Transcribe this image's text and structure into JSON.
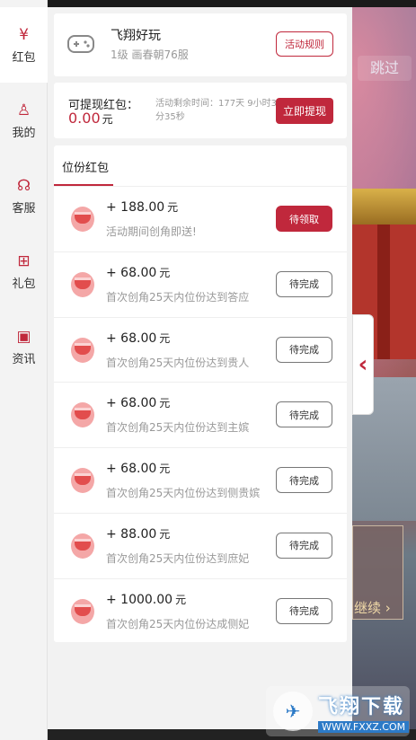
{
  "sidebar": {
    "items": [
      {
        "label": "红包",
        "icon": "red-envelope-icon",
        "glyph": "¥",
        "active": true
      },
      {
        "label": "我的",
        "icon": "user-icon",
        "glyph": "♙",
        "active": false
      },
      {
        "label": "客服",
        "icon": "headset-icon",
        "glyph": "☊",
        "active": false
      },
      {
        "label": "礼包",
        "icon": "gift-icon",
        "glyph": "⊞",
        "active": false
      },
      {
        "label": "资讯",
        "icon": "news-icon",
        "glyph": "▣",
        "active": false
      }
    ]
  },
  "game": {
    "title": "飞翔好玩",
    "subtitle": "1级 画春朝76服",
    "rules_label": "活动规则"
  },
  "balance": {
    "label": "可提现红包：",
    "amount": "0.00",
    "unit": "元",
    "time_text": "活动剩余时间：177天 9小时3分35秒",
    "withdraw_label": "立即提现"
  },
  "tab": {
    "label": "位份红包"
  },
  "rows": [
    {
      "amount": "+ 188.00",
      "unit": "元",
      "desc": "活动期间创角即送!",
      "status": "待领取",
      "claimable": true
    },
    {
      "amount": "+ 68.00",
      "unit": "元",
      "desc": "首次创角25天内位份达到答应",
      "status": "待完成",
      "claimable": false
    },
    {
      "amount": "+ 68.00",
      "unit": "元",
      "desc": "首次创角25天内位份达到贵人",
      "status": "待完成",
      "claimable": false
    },
    {
      "amount": "+ 68.00",
      "unit": "元",
      "desc": "首次创角25天内位份达到主嫔",
      "status": "待完成",
      "claimable": false
    },
    {
      "amount": "+ 68.00",
      "unit": "元",
      "desc": "首次创角25天内位份达到侧贵嫔",
      "status": "待完成",
      "claimable": false
    },
    {
      "amount": "+ 88.00",
      "unit": "元",
      "desc": "首次创角25天内位份达到庶妃",
      "status": "待完成",
      "claimable": false
    },
    {
      "amount": "+ 1000.00",
      "unit": "元",
      "desc": "首次创角25天内位份达成侧妃",
      "status": "待完成",
      "claimable": false
    }
  ],
  "background": {
    "skip_label": "跳过",
    "continue_label": "继续",
    "collapse_glyph": "‹"
  },
  "watermark": {
    "name": "飞翔下载",
    "url": "WWW.FXXZ.COM"
  },
  "colors": {
    "accent": "#c0283c",
    "muted_text": "#999999"
  }
}
